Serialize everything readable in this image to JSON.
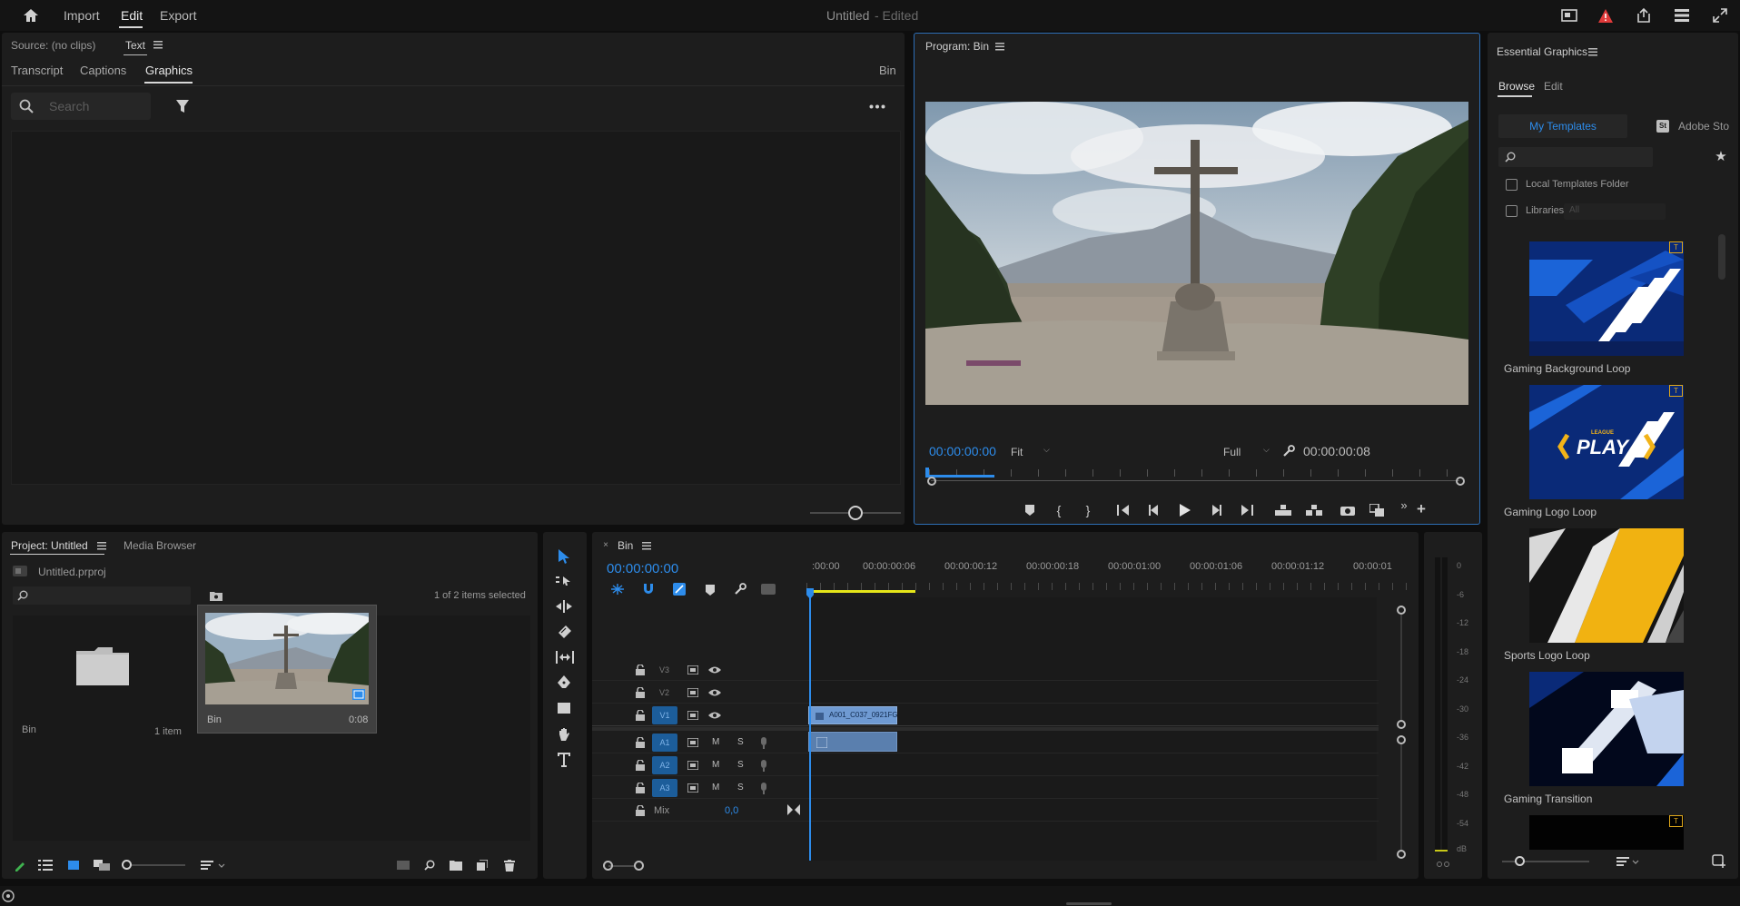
{
  "topbar": {
    "menus": [
      "Import",
      "Edit",
      "Export"
    ],
    "active_menu": "Edit",
    "title": "Untitled",
    "status": "- Edited"
  },
  "source_panel": {
    "source_label": "Source: (no clips)",
    "text_tab": "Text",
    "tabs": [
      "Transcript",
      "Captions",
      "Graphics"
    ],
    "active_tab": "Graphics",
    "bin_label": "Bin",
    "search_placeholder": "Search"
  },
  "program_panel": {
    "title": "Program: Bin",
    "timecode_current": "00:00:00:00",
    "fit_label": "Fit",
    "quality_label": "Full",
    "timecode_duration": "00:00:00:08"
  },
  "project_panel": {
    "tab_project": "Project: Untitled",
    "tab_media_browser": "Media Browser",
    "file_name": "Untitled.prproj",
    "selection_status": "1 of 2 items selected",
    "items": [
      {
        "name": "Bin",
        "meta": "1 item",
        "kind": "folder"
      },
      {
        "name": "Bin",
        "meta": "0:08",
        "kind": "sequence"
      }
    ]
  },
  "timeline": {
    "sequence_name": "Bin",
    "timecode": "00:00:00:00",
    "ruler_ticks": [
      ":00:00",
      "00:00:00:06",
      "00:00:00:12",
      "00:00:00:18",
      "00:00:01:00",
      "00:00:01:06",
      "00:00:01:12",
      "00:00:01"
    ],
    "video_tracks": [
      "V3",
      "V2",
      "V1"
    ],
    "audio_tracks": [
      "A1",
      "A2",
      "A3"
    ],
    "mute_label": "M",
    "solo_label": "S",
    "mix_label": "Mix",
    "mix_value": "0,0",
    "clip_name": "A001_C037_0921FG"
  },
  "audio_meter": {
    "labels": [
      "0",
      "-6",
      "-12",
      "-18",
      "-24",
      "-30",
      "-36",
      "-42",
      "-48",
      "-54",
      "dB"
    ]
  },
  "essential_graphics": {
    "title": "Essential Graphics",
    "tabs": [
      "Browse",
      "Edit"
    ],
    "active_tab": "Browse",
    "source_my_templates": "My Templates",
    "source_adobe_stock": "Adobe Sto",
    "stock_badge": "St",
    "local_templates_label": "Local Templates Folder",
    "libraries_label": "Libraries",
    "libraries_select": "All",
    "templates": [
      {
        "title": "Gaming Background Loop"
      },
      {
        "title": "Gaming Logo Loop",
        "overlay_text": "PLAY",
        "overlay_small": "LEAGUE"
      },
      {
        "title": "Sports Logo Loop"
      },
      {
        "title": "Gaming Transition"
      }
    ]
  },
  "colors": {
    "accent": "#2d8ceb",
    "panel_bg": "#1d1d1d",
    "app_bg": "#0e0e0e",
    "playhead": "#2d8ceb",
    "workarea": "#e6e619",
    "warning": "#e03a3a"
  }
}
